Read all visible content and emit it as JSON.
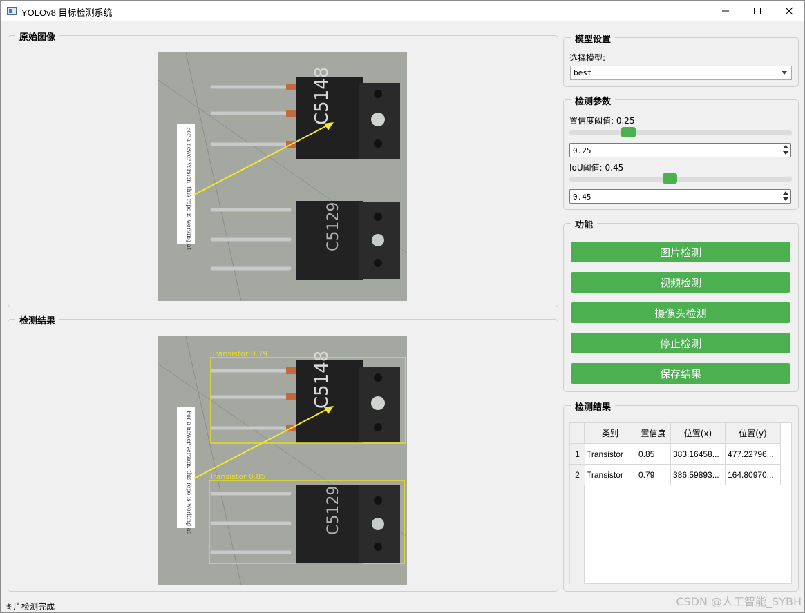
{
  "window": {
    "title": "YOLOv8 目标检测系统"
  },
  "left": {
    "original_title": "原始图像",
    "result_title": "检测结果",
    "detections": [
      {
        "label": "Transistor 0.79"
      },
      {
        "label": "Transistor 0.85"
      }
    ],
    "image_markings": {
      "chip_text_top": "C5148",
      "chip_text_bottom": "C5129",
      "note_text": "For a newer version, this repo is working at"
    }
  },
  "model": {
    "group_title": "模型设置",
    "select_label": "选择模型:",
    "selected": "best"
  },
  "params": {
    "group_title": "检测参数",
    "conf_label": "置信度阈值: 0.25",
    "conf_value": "0.25",
    "conf_level": 0.25,
    "iou_label": "IoU阈值: 0.45",
    "iou_value": "0.45",
    "iou_level": 0.45
  },
  "functions": {
    "group_title": "功能",
    "buttons": [
      "图片检测",
      "视频检测",
      "摄像头检测",
      "停止检测",
      "保存结果"
    ]
  },
  "results": {
    "group_title": "检测结果",
    "columns": [
      "类别",
      "置信度",
      "位置(x)",
      "位置(y)"
    ],
    "rows": [
      {
        "index": "1",
        "cells": [
          "Transistor",
          "0.85",
          "383.16458...",
          "477.22796..."
        ]
      },
      {
        "index": "2",
        "cells": [
          "Transistor",
          "0.79",
          "386.59893...",
          "164.80970..."
        ]
      }
    ]
  },
  "status": "图片检测完成",
  "watermark": "CSDN @人工智能_SYBH",
  "colors": {
    "accent_green": "#4caf50",
    "box_yellow": "#e6e01e"
  }
}
